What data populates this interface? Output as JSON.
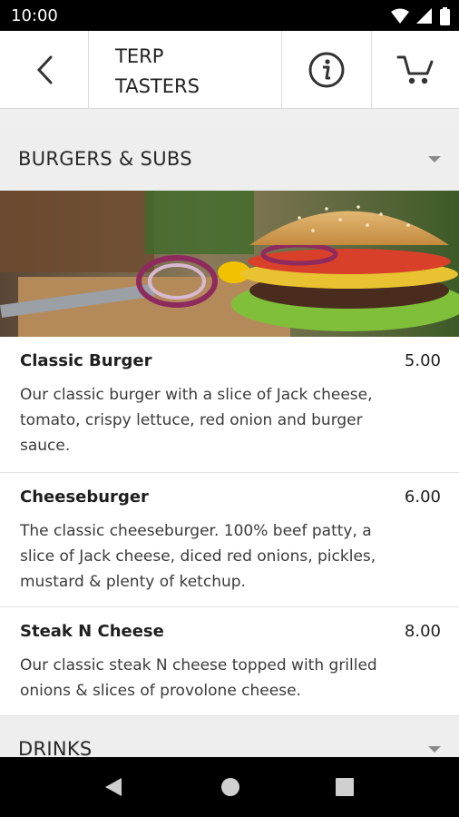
{
  "status_bar": {
    "time": "10:00"
  },
  "header": {
    "title_line1": "TERP",
    "title_line2": "TASTERS"
  },
  "sections": [
    {
      "label": "BURGERS & SUBS",
      "items": [
        {
          "name": "Classic Burger",
          "price": "5.00",
          "description": "Our classic burger with a slice of Jack cheese, tomato, crispy lettuce, red onion and burger sauce."
        },
        {
          "name": "Cheeseburger",
          "price": "6.00",
          "description": "The classic cheeseburger. 100% beef patty, a slice of Jack cheese, diced red onions, pickles, mustard & plenty of ketchup."
        },
        {
          "name": "Steak N Cheese",
          "price": "8.00",
          "description": "Our classic steak N cheese topped with grilled onions & slices of provolone cheese."
        }
      ]
    },
    {
      "label": "DRINKS"
    }
  ],
  "icons": {
    "back": "arrow-back-icon",
    "info": "info-icon",
    "cart": "cart-icon"
  }
}
